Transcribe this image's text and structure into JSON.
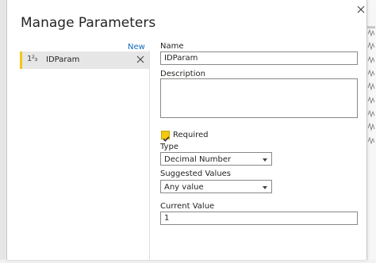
{
  "dialog": {
    "title": "Manage Parameters",
    "close_icon": "close-icon"
  },
  "list": {
    "new_label": "New",
    "items": [
      {
        "type_icon": "1²₃",
        "label": "IDParam"
      }
    ]
  },
  "form": {
    "name_label": "Name",
    "name_value": "IDParam",
    "description_label": "Description",
    "description_value": "",
    "required_label": "Required",
    "required_checked": true,
    "type_label": "Type",
    "type_value": "Decimal Number",
    "suggested_label": "Suggested Values",
    "suggested_value": "Any value",
    "current_label": "Current Value",
    "current_value": "1"
  },
  "colors": {
    "accent": "#f2c811",
    "link": "#0f6cbd"
  }
}
